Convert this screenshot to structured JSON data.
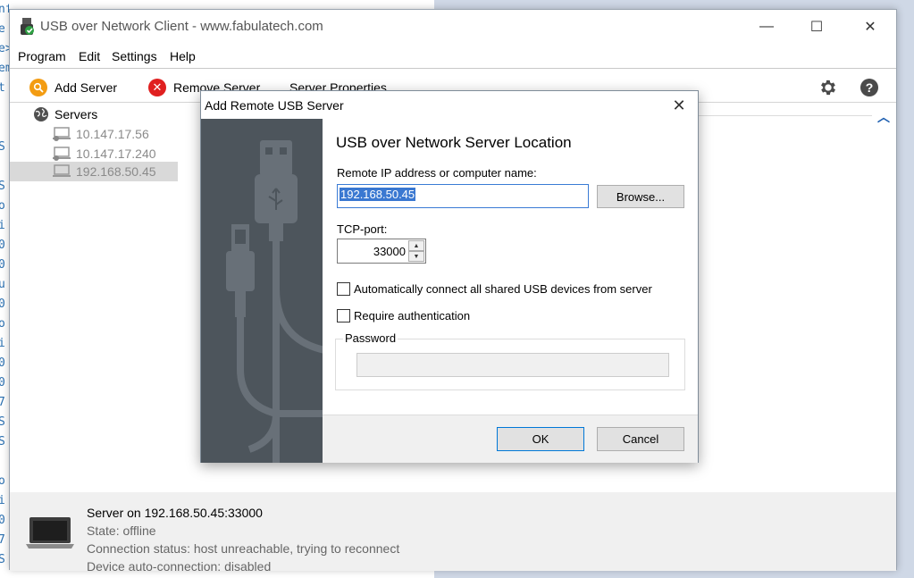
{
  "background": {
    "code_lines": [
      "nformatio",
      "e",
      "e>",
      "em",
      "t",
      "",
      "",
      "S",
      "",
      "S",
      "o",
      "i",
      "0",
      "0",
      "u",
      "0",
      "o",
      "i",
      "0",
      "0",
      "7",
      "S",
      "S",
      "",
      "o",
      "i",
      "0",
      "7",
      "S"
    ]
  },
  "window": {
    "title": "USB over Network Client - www.fabulatech.com",
    "minimize_glyph": "—",
    "maximize_glyph": "☐",
    "close_glyph": "✕"
  },
  "menu": {
    "items": [
      "Program",
      "Edit",
      "Settings",
      "Help"
    ]
  },
  "toolbar": {
    "add_server": "Add Server",
    "remove_server": "Remove Server",
    "server_properties": "Server Properties",
    "help_glyph": "?"
  },
  "tree": {
    "root": "Servers",
    "servers": [
      {
        "address": "10.147.17.56"
      },
      {
        "address": "10.147.17.240"
      },
      {
        "address": "192.168.50.45",
        "selected": true
      }
    ]
  },
  "status": {
    "title": "Server on 192.168.50.45:33000",
    "state": "State: offline",
    "connection": "Connection status: host unreachable, trying to reconnect",
    "auto_connection": "Device auto-connection: disabled"
  },
  "dialog": {
    "title": "Add Remote USB Server",
    "close_glyph": "✕",
    "heading": "USB over Network Server Location",
    "ip_label": "Remote IP address or computer name:",
    "ip_value": "192.168.50.45",
    "browse_label": "Browse...",
    "port_label": "TCP-port:",
    "port_value": "33000",
    "auto_connect_label": "Automatically connect all shared USB devices from server",
    "auto_connect_checked": false,
    "require_auth_label": "Require authentication",
    "require_auth_checked": false,
    "password_label": "Password",
    "password_value": "",
    "ok_label": "OK",
    "cancel_label": "Cancel"
  },
  "colors": {
    "accent_blue": "#0078d7",
    "sidebar_dark": "#4d555c",
    "add_icon": "#f39c12",
    "remove_icon": "#e02020"
  }
}
